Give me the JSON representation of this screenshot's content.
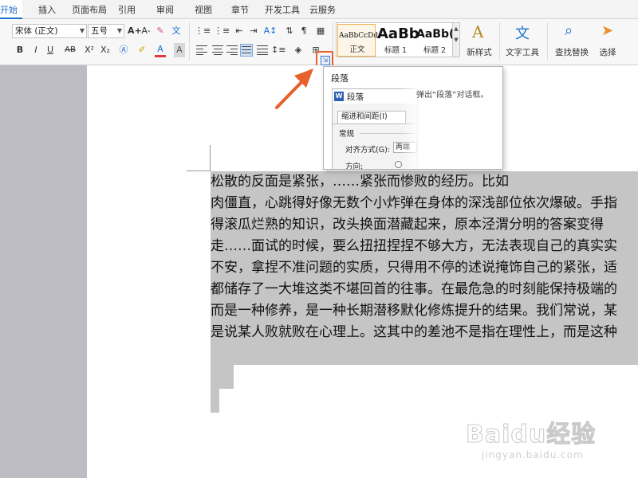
{
  "tabs": [
    "开始",
    "插入",
    "页面布局",
    "引用",
    "审阅",
    "视图",
    "章节",
    "开发工具",
    "云服务"
  ],
  "ribbon": {
    "font_name": "宋体 (正文)",
    "font_size": "五号",
    "grow_font": "A+",
    "shrink_font": "A-",
    "bold": "B",
    "italic": "I",
    "underline": "U",
    "strikethrough": "AB",
    "superscript": "X²",
    "subscript": "X₂",
    "font_color": "A",
    "styles": [
      {
        "sample": "AaBbCcDd",
        "name": "正文"
      },
      {
        "sample": "AaBb",
        "name": "标题 1"
      },
      {
        "sample": "AaBb(",
        "name": "标题 2"
      }
    ],
    "new_style": "新样式",
    "text_tools": "文字工具",
    "find_replace": "查找替换",
    "select": "选择",
    "colors": {
      "accent": "#1e6fd0",
      "highlight": "#e8602c"
    }
  },
  "tooltip": {
    "title": "段落",
    "description": "弹出“段落”对话框。",
    "dialog": {
      "title": "段落",
      "tab": "缩进和间距(I)",
      "group": "常规",
      "align_label": "对齐方式(G):",
      "align_value": "两端",
      "direction_label": "方向:"
    }
  },
  "document": {
    "lines": [
      "松散的反面是紧张，……紧张而惨败的经历。比如",
      "肉僵直，心跳得好像无数个小炸弹在身体的深浅部位依次爆破。手指",
      "得滚瓜烂熟的知识，改头换面潜藏起来，原本泾渭分明的答案变得",
      "走……面试的时候，要么扭扭捏捏不够大方，无法表现自己的真实实",
      "不安，拿捏不准问题的实质，只得用不停的述说掩饰自己的紧张，适",
      "都储存了一大堆这类不堪回首的往事。在最危急的时刻能保持极端的",
      "而是一种修养，是一种长期潜移默化修炼提升的结果。我们常说，某",
      "是说某人败就败在心理上。这其中的差池不是指在理性上，而是这种"
    ]
  },
  "watermark": {
    "logo": "Baidu经验",
    "sub": "jingyan.baidu.com"
  }
}
